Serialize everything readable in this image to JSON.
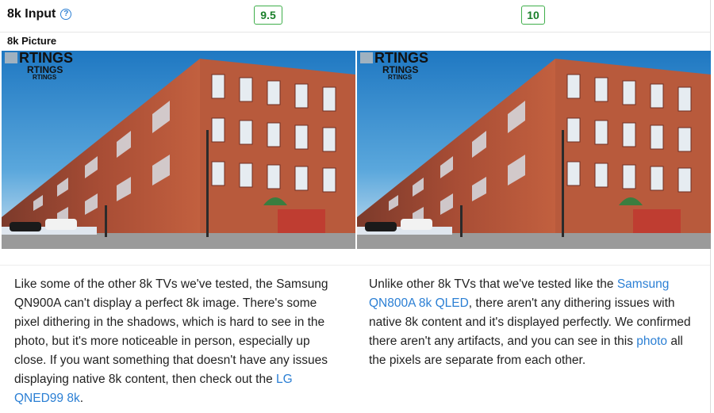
{
  "section": {
    "title": "8k Input",
    "help_icon": "question-circle-icon",
    "scores": {
      "left": "9.5",
      "right": "10"
    },
    "score_color": "#3fae4a"
  },
  "sub_section": {
    "title": "8k Picture"
  },
  "images": {
    "watermark": "RTINGS",
    "left_label": "8k picture test photo - left",
    "right_label": "8k picture test photo - right"
  },
  "descriptions": {
    "left": {
      "text_before": "Like some of the other 8k TVs we've tested, the Samsung QN900A can't display a perfect 8k image. There's some pixel dithering in the shadows, which is hard to see in the photo, but it's more noticeable in person, especially up close. If you want something that doesn't have any issues displaying native 8k content, then check out the ",
      "link": "LG QNED99 8k",
      "text_after": "."
    },
    "right": {
      "text_a": "Unlike other 8k TVs that we've tested like the ",
      "link1": "Samsung QN800A 8k QLED",
      "text_b": ", there aren't any dithering issues with native 8k content and it's displayed perfectly. We confirmed there aren't any artifacts, and you can see in this ",
      "link2": "photo",
      "text_c": " all the pixels are separate from each other."
    }
  },
  "colors": {
    "link": "#2b7fd4",
    "brick": "#b4533a",
    "sky": "#2d82c6"
  }
}
